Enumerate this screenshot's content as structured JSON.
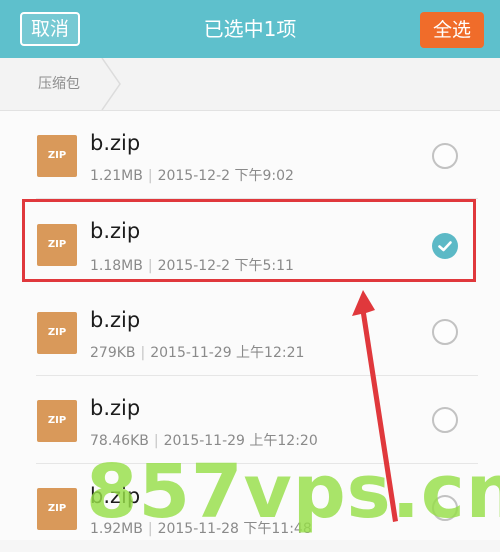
{
  "header": {
    "cancel_label": "取消",
    "title": "已选中1项",
    "select_all_label": "全选",
    "background": "#5ec0cc",
    "accent": "#f06c2a"
  },
  "breadcrumb": {
    "label": "压缩包"
  },
  "files": [
    {
      "icon": "zip-file-icon",
      "icon_text": "ZIP",
      "name": "b.zip",
      "size": "1.21MB",
      "date": "2015-12-2 下午9:02",
      "selected": false
    },
    {
      "icon": "zip-file-icon",
      "icon_text": "ZIP",
      "name": "b.zip",
      "size": "1.18MB",
      "date": "2015-12-2 下午5:11",
      "selected": true
    },
    {
      "icon": "zip-file-icon",
      "icon_text": "ZIP",
      "name": "b.zip",
      "size": "279KB",
      "date": "2015-11-29 上午12:21",
      "selected": false
    },
    {
      "icon": "zip-file-icon",
      "icon_text": "ZIP",
      "name": "b.zip",
      "size": "78.46KB",
      "date": "2015-11-29 上午12:20",
      "selected": false
    },
    {
      "icon": "zip-file-icon",
      "icon_text": "ZIP",
      "name": "b.zip",
      "size": "1.92MB",
      "date": "2015-11-28 下午11:48",
      "selected": false
    }
  ],
  "annotation": {
    "highlight_color": "#e0383c"
  },
  "watermark": {
    "text": "857vps.cn"
  }
}
